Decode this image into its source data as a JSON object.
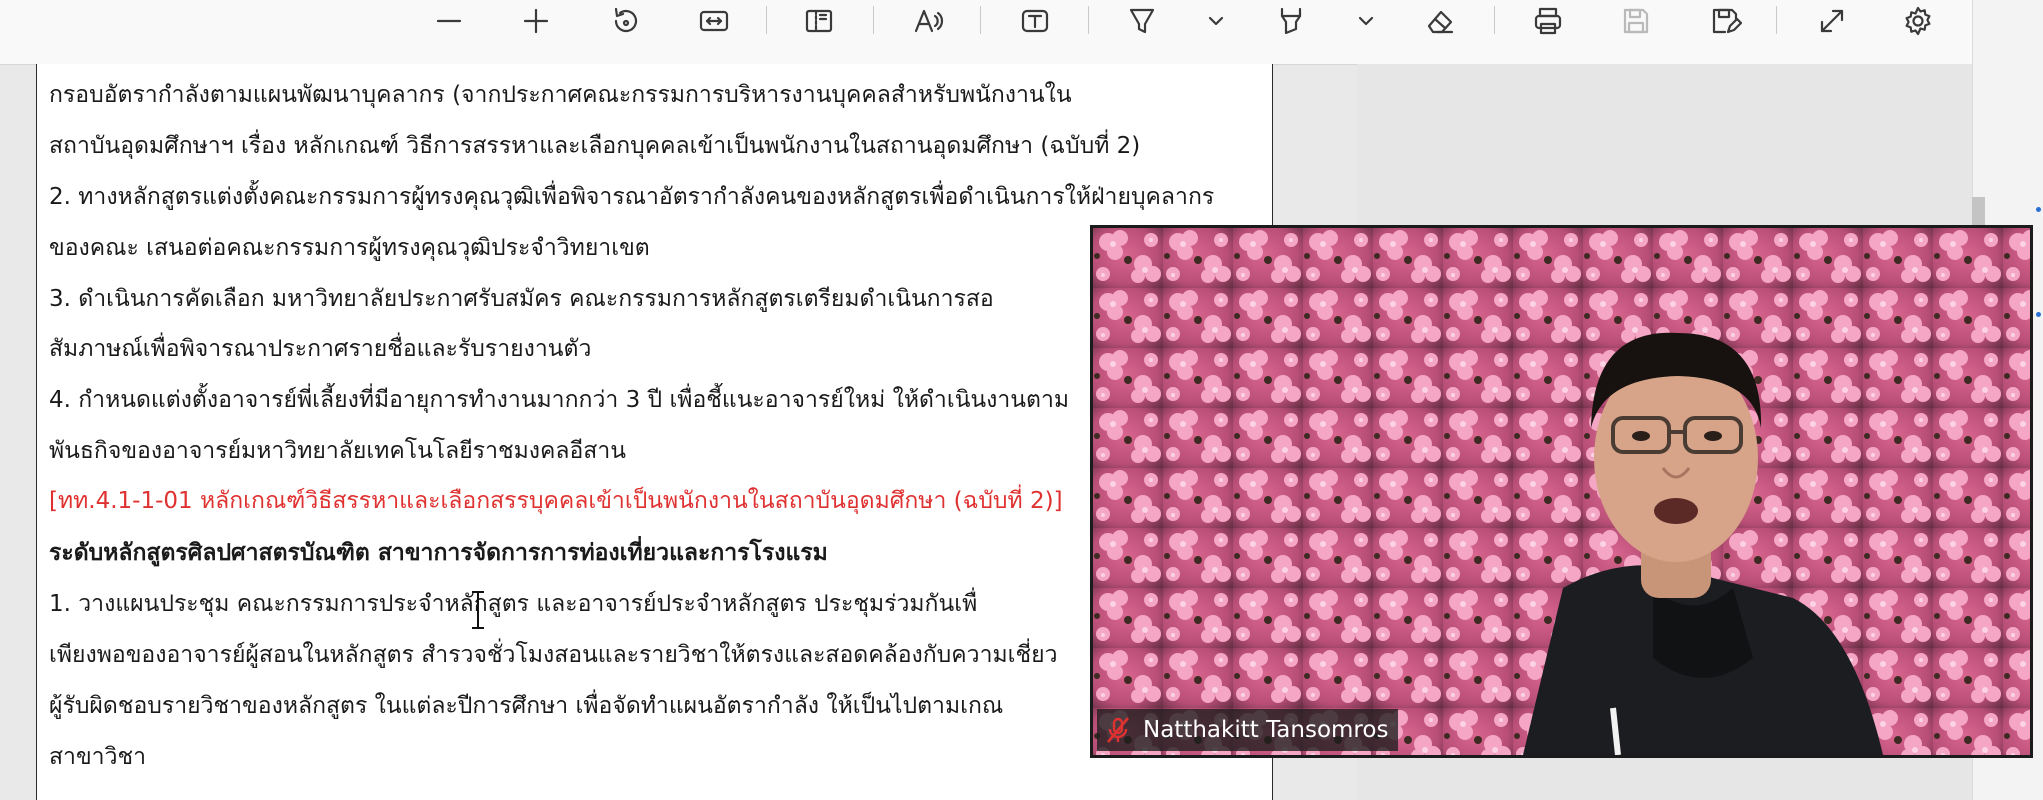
{
  "toolbar": {
    "buttons": [
      {
        "name": "zoom-out-button",
        "icon": "minus-icon"
      },
      {
        "name": "zoom-in-button",
        "icon": "plus-icon"
      },
      {
        "name": "rotate-button",
        "icon": "rotate-icon"
      },
      {
        "name": "fit-width-button",
        "icon": "fit-width-icon"
      },
      {
        "name": "page-view-button",
        "icon": "page-view-icon"
      },
      {
        "name": "read-aloud-button",
        "icon": "read-aloud-icon"
      },
      {
        "name": "text-box-button",
        "icon": "text-box-icon"
      },
      {
        "name": "draw-button",
        "icon": "pen-icon"
      },
      {
        "name": "highlight-button",
        "icon": "highlighter-icon"
      },
      {
        "name": "erase-button",
        "icon": "eraser-icon"
      },
      {
        "name": "print-button",
        "icon": "printer-icon"
      },
      {
        "name": "save-button",
        "icon": "save-icon"
      },
      {
        "name": "save-as-button",
        "icon": "save-as-icon"
      },
      {
        "name": "fullscreen-button",
        "icon": "expand-icon"
      },
      {
        "name": "settings-button",
        "icon": "gear-icon"
      }
    ]
  },
  "document": {
    "lines": [
      {
        "text": "กรอบอัตรากำลังตามแผนพัฒนาบุคลากร (จากประกาศคณะกรรมการบริหารงานบุคคลสำหรับพนักงานใน",
        "style": "normal"
      },
      {
        "text": "สถาบันอุดมศึกษาฯ เรื่อง หลักเกณฑ์ วิธีการสรรหาและเลือกบุคคลเข้าเป็นพนักงานในสถานอุดมศึกษา (ฉบับที่ 2)",
        "style": "normal"
      },
      {
        "text": "2. ทางหลักสูตรแต่งตั้งคณะกรรมการผู้ทรงคุณวุฒิเพื่อพิจารณาอัตรากำลังคนของหลักสูตรเพื่อดำเนินการให้ฝ่ายบุคลากร",
        "style": "normal"
      },
      {
        "text": "ของคณะ เสนอต่อคณะกรรมการผู้ทรงคุณวุฒิประจำวิทยาเขต",
        "style": "normal"
      },
      {
        "text": "3. ดำเนินการคัดเลือก มหาวิทยาลัยประกาศรับสมัคร คณะกรรมการหลักสูตรเตรียมดำเนินการสอ",
        "style": "normal"
      },
      {
        "text": "สัมภาษณ์เพื่อพิจารณาประกาศรายชื่อและรับรายงานตัว",
        "style": "normal"
      },
      {
        "text": "4. กำหนดแต่งตั้งอาจารย์พี่เลี้ยงที่มีอายุการทำงานมากกว่า 3 ปี เพื่อชี้แนะอาจารย์ใหม่ ให้ดำเนินงานตาม",
        "style": "normal"
      },
      {
        "text": "พันธกิจของอาจารย์มหาวิทยาลัยเทคโนโลยีราชมงคลอีสาน",
        "style": "normal"
      },
      {
        "text": "[ทท.4.1-1-01 หลักเกณฑ์วิธีสรรหาและเลือกสรรบุคคลเข้าเป็นพนักงานในสถาบันอุดมศึกษา (ฉบับที่ 2)]",
        "style": "red"
      },
      {
        "text": "ระดับหลักสูตรศิลปศาสตรบัณฑิต สาขาการจัดการการท่องเที่ยวและการโรงแรม",
        "style": "bold"
      },
      {
        "text": " 1. วางแผนประชุม คณะกรรมการประจำหลักสูตร และอาจารย์ประจำหลักสูตร ประชุมร่วมกันเพื่",
        "style": "normal"
      },
      {
        "text": "เพียงพอของอาจารย์ผู้สอนในหลักสูตร สำรวจชั่วโมงสอนและรายวิชาให้ตรงและสอดคล้องกับความเชี่ยว",
        "style": "normal"
      },
      {
        "text": "ผู้รับผิดชอบรายวิชาของหลักสูตร ในแต่ละปีการศึกษา เพื่อจัดทำแผนอัตรากำลัง ให้เป็นไปตามเกณ",
        "style": "normal"
      },
      {
        "text": "สาขาวิชา",
        "style": "normal"
      }
    ]
  },
  "video_call": {
    "participant_name": "Natthakitt Tansomros",
    "mic_status_icon": "mic-muted-icon",
    "mic_color": "#e03131"
  },
  "colors": {
    "reference_red": "#e03131",
    "page_background": "#ffffff",
    "toolbar_background": "#f9f9f9"
  }
}
